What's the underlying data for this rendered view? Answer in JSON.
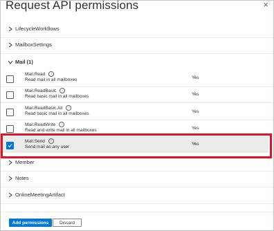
{
  "panel": {
    "title": "Request API permissions",
    "close_glyph": "×"
  },
  "groups_top": [
    {
      "label": "LifecycleWorkflows"
    },
    {
      "label": "MailboxSettings"
    }
  ],
  "mail_group": {
    "label": "Mail (1)"
  },
  "permissions": [
    {
      "name": "Mail.Read",
      "description": "Read mail in all mailboxes",
      "admin_consent": "Yes",
      "checked": false
    },
    {
      "name": "Mail.ReadBasic",
      "description": "Read basic mail in all mailboxes",
      "admin_consent": "Yes",
      "checked": false
    },
    {
      "name": "Mail.ReadBasic.All",
      "description": "Read basic mail in all mailboxes",
      "admin_consent": "Yes",
      "checked": false
    },
    {
      "name": "Mail.ReadWrite",
      "description": "Read and write mail in all mailboxes",
      "admin_consent": "Yes",
      "checked": false
    },
    {
      "name": "Mail.Send",
      "description": "Send mail as any user",
      "admin_consent": "Yes",
      "checked": true
    }
  ],
  "groups_bottom": [
    {
      "label": "Member"
    },
    {
      "label": "Notes"
    },
    {
      "label": "OnlineMeetingArtifact"
    }
  ],
  "footer": {
    "add_label": "Add permissions",
    "discard_label": "Discard"
  },
  "colors": {
    "accent": "#0078d4",
    "highlight": "#e81123",
    "selected_row": "#edebe9"
  },
  "icons": {
    "chevron_right": "chevron-right-icon",
    "chevron_down": "chevron-down-icon",
    "info": "info-icon",
    "check": "checkmark-icon",
    "close": "close-icon"
  }
}
